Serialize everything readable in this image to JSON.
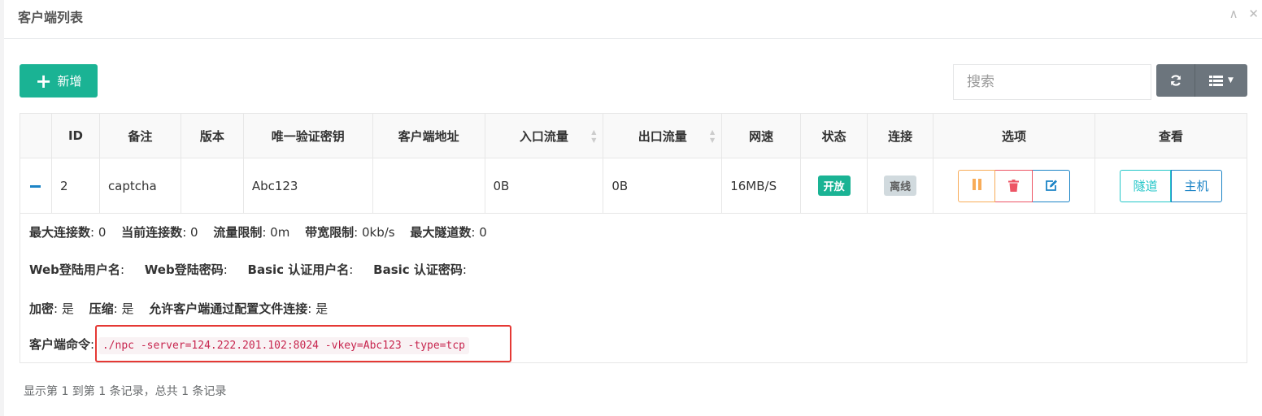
{
  "panel": {
    "title": "客户端列表"
  },
  "header_icons": {
    "collapse": "∧",
    "close": "✕"
  },
  "toolbar": {
    "add_label": "新增",
    "search_placeholder": "搜索",
    "refresh_icon": "refresh-icon",
    "columns_icon": "columns-icon"
  },
  "table": {
    "headers": [
      "ID",
      "备注",
      "版本",
      "唯一验证密钥",
      "客户端地址",
      "入口流量",
      "出口流量",
      "网速",
      "状态",
      "连接",
      "选项",
      "查看"
    ],
    "rows": [
      {
        "id": "2",
        "remark": "captcha",
        "version": "",
        "vkey": "Abc123",
        "address": "",
        "in_flow": "0B",
        "out_flow": "0B",
        "speed": "16MB/S",
        "status": "开放",
        "conn": "离线",
        "view_tunnel": "隧道",
        "view_host": "主机"
      }
    ]
  },
  "detail": {
    "max_conn_label": "最大连接数",
    "max_conn": ": 0",
    "cur_conn_label": "当前连接数",
    "cur_conn": ": 0",
    "flow_limit_label": "流量限制",
    "flow_limit": ": 0m",
    "rate_limit_label": "带宽限制",
    "rate_limit": ": 0kb/s",
    "max_tunnel_label": "最大隧道数",
    "max_tunnel": ": 0",
    "web_user_label": "Web登陆用户名",
    "web_user": ":",
    "web_pass_label": "Web登陆密码",
    "web_pass": ":",
    "basic_user_label": "Basic 认证用户名",
    "basic_user": ":",
    "basic_pass_label": "Basic 认证密码",
    "basic_pass": ":",
    "encrypt_label": "加密",
    "encrypt": ": 是",
    "compress_label": "压缩",
    "compress": ": 是",
    "config_conn_label": "允许客户端通过配置文件连接",
    "config_conn": ": 是",
    "cmd_label": "客户端命令",
    "cmd_sep": ":",
    "cmd": "./npc -server=124.222.201.102:8024 -vkey=Abc123 -type=tcp"
  },
  "footer": {
    "summary": "显示第 1 到第 1 条记录，总共 1 条记录"
  },
  "colors": {
    "primary": "#1ab394",
    "danger": "#ed5565",
    "warning": "#f8ac59",
    "info": "#1c84c6",
    "highlight": "#e53935"
  }
}
